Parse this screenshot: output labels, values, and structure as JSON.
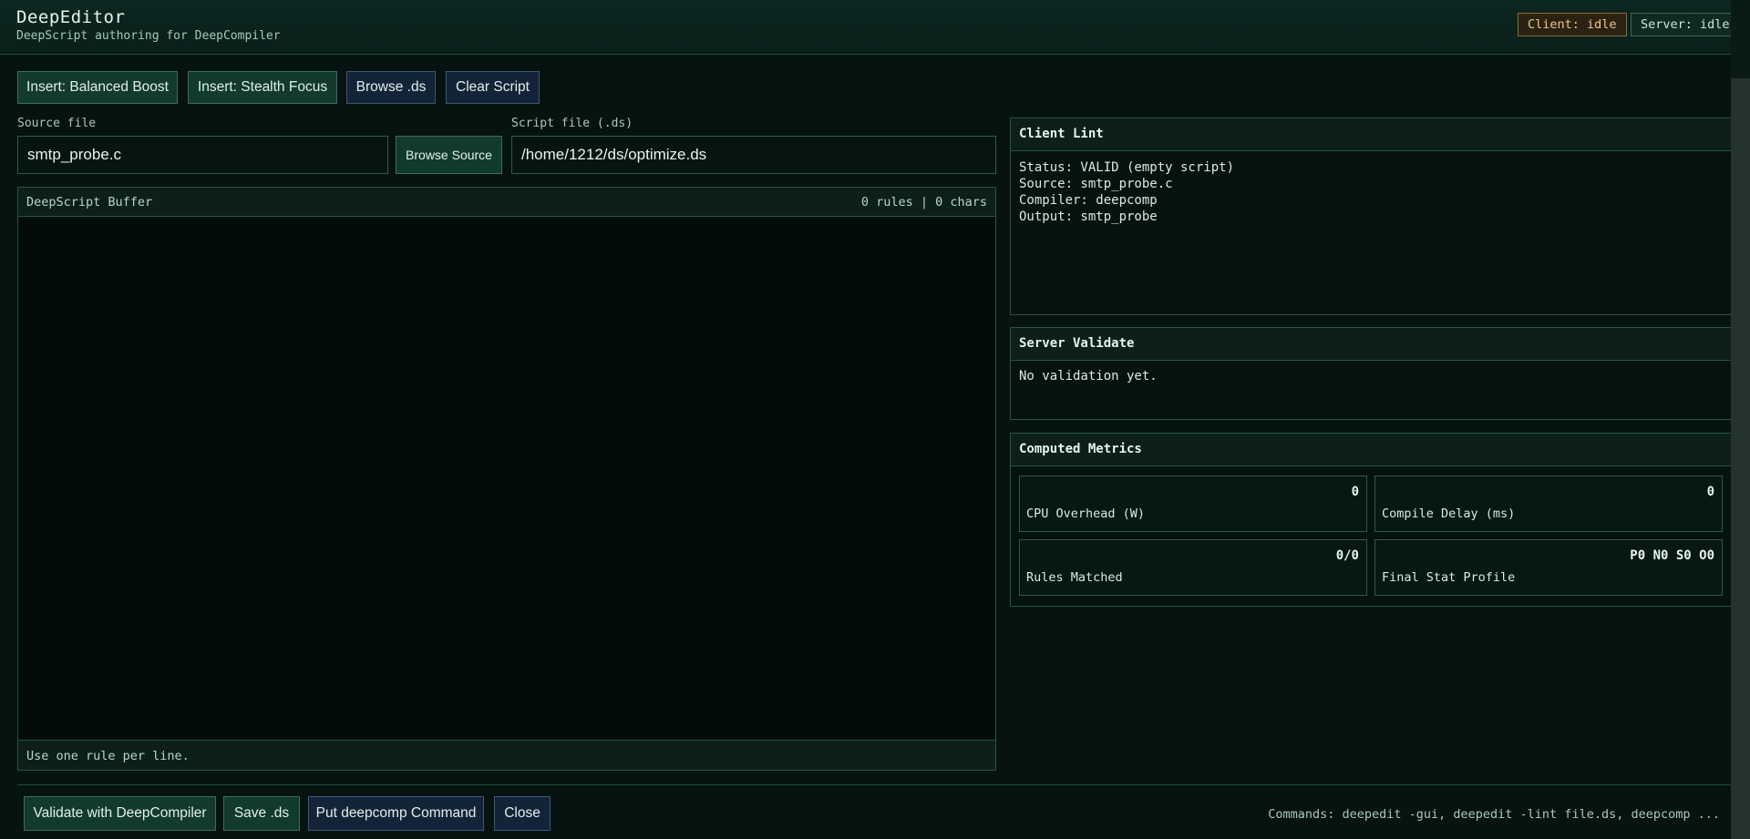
{
  "header": {
    "title": "DeepEditor",
    "subtitle": "DeepScript authoring for DeepCompiler",
    "client_status": "Client: idle",
    "server_status": "Server: idle",
    "client_color": "#f0c48a",
    "server_color": "#cfe6dc"
  },
  "toolbar": {
    "insert_balanced": "Insert: Balanced Boost",
    "insert_stealth": "Insert: Stealth Focus",
    "browse_ds": "Browse .ds",
    "clear_script": "Clear Script"
  },
  "source": {
    "label": "Source file",
    "value": "smtp_probe.c",
    "browse_label": "Browse Source"
  },
  "script": {
    "label": "Script file (.ds)",
    "value": "/home/1212/ds/optimize.ds"
  },
  "buffer": {
    "title": "DeepScript Buffer",
    "stats": "0 rules | 0 chars",
    "content": "",
    "hint": "Use one rule per line."
  },
  "client_lint": {
    "title": "Client Lint",
    "lines": [
      "Status: VALID (empty script)",
      "Source: smtp_probe.c",
      "Compiler: deepcomp",
      "Output: smtp_probe"
    ]
  },
  "server_validate": {
    "title": "Server Validate",
    "message": "No validation yet."
  },
  "metrics": {
    "title": "Computed Metrics",
    "items": [
      {
        "label": "CPU Overhead (W)",
        "value": "0"
      },
      {
        "label": "Compile Delay (ms)",
        "value": "0"
      },
      {
        "label": "Rules Matched",
        "value": "0/0"
      },
      {
        "label": "Final Stat Profile",
        "value": "P0 N0 S0 O0"
      }
    ]
  },
  "footer": {
    "validate": "Validate with DeepCompiler",
    "save": "Save .ds",
    "put_command": "Put deepcomp Command",
    "close": "Close",
    "commands": "Commands: deepedit -gui, deepedit -lint file.ds, deepcomp ..."
  },
  "colors": {
    "background": "#071310",
    "accent_green": "#123a2f",
    "accent_blue": "#142438",
    "border": "#2a5244"
  }
}
